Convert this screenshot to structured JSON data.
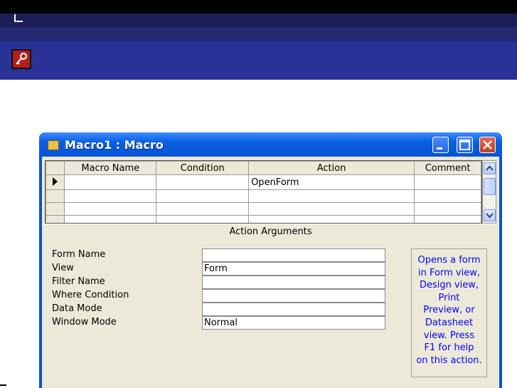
{
  "window": {
    "title": "Macro1 : Macro"
  },
  "grid": {
    "columns": [
      "Macro Name",
      "Condition",
      "Action",
      "Comment"
    ],
    "rows": [
      {
        "macro_name": "",
        "condition": "",
        "action": "OpenForm",
        "comment": ""
      },
      {
        "macro_name": "",
        "condition": "",
        "action": "",
        "comment": ""
      },
      {
        "macro_name": "",
        "condition": "",
        "action": "",
        "comment": ""
      },
      {
        "macro_name": "",
        "condition": "",
        "action": "",
        "comment": ""
      }
    ]
  },
  "arguments": {
    "header": "Action Arguments",
    "fields": [
      {
        "label": "Form Name",
        "value": ""
      },
      {
        "label": "View",
        "value": "Form"
      },
      {
        "label": "Filter Name",
        "value": ""
      },
      {
        "label": "Where Condition",
        "value": ""
      },
      {
        "label": "Data Mode",
        "value": ""
      },
      {
        "label": "Window Mode",
        "value": "Normal"
      }
    ],
    "help_lines": [
      "Opens a form",
      "in Form view,",
      "Design view,",
      "Print",
      "Preview, or",
      "Datasheet",
      "view. Press",
      "F1 for help",
      "on this action."
    ]
  },
  "colors": {
    "header_band": "#2a3298",
    "window_frame": "#0a53d9",
    "help_text": "#0000ff"
  },
  "icons": [
    "key-app-icon",
    "macro-icon",
    "minimize-icon",
    "maximize-icon",
    "close-icon",
    "record-selector-icon",
    "scroll-up-icon",
    "scroll-down-icon"
  ]
}
